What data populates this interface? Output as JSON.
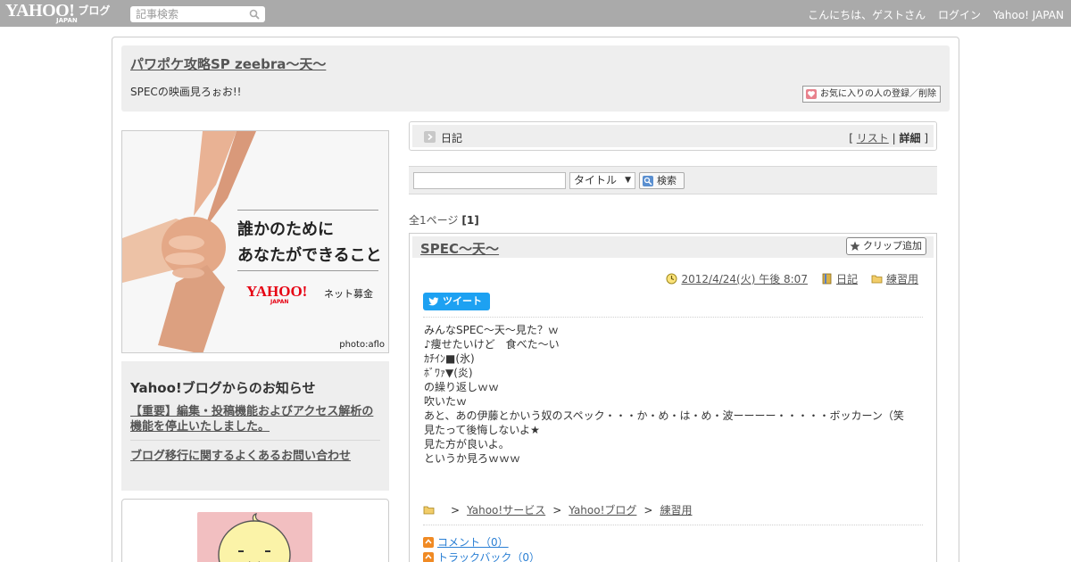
{
  "topbar": {
    "logo_text": "YAHOO!",
    "logo_sub": "JAPAN",
    "logo_blog": "ブログ",
    "search_placeholder": "記事検索",
    "greeting": "こんにちは、ゲストさん",
    "login": "ログイン",
    "yahoo_japan": "Yahoo! JAPAN"
  },
  "header": {
    "blog_title": "パワポケ攻略SP zeebra～天～",
    "description": "SPECの映画見ろぉお!!",
    "favorite_button": "お気に入りの人の登録／削除"
  },
  "banner": {
    "line1": "誰かのために",
    "line2": "あなたができること",
    "logo": "YAHOO!",
    "logo_sub": "JAPAN",
    "tagline": "ネット募金",
    "credit": "photo:aflo"
  },
  "notice": {
    "title": "Yahoo!ブログからのお知らせ",
    "link1": "【重要】編集・投稿機能およびアクセス解析の機能を停止いたしました。",
    "link2": "ブログ移行に関するよくあるお問い合わせ"
  },
  "category_bar": {
    "label": "日記",
    "view_open": "[",
    "view_list": "リスト",
    "view_sep": "|",
    "view_detail": "詳細",
    "view_close": "]"
  },
  "article_search": {
    "select_value": "タイトル",
    "button": "検索"
  },
  "page_info": {
    "text": "全1ページ",
    "current": "[1]"
  },
  "article": {
    "title": "SPEC～天～",
    "clip_button": "クリップ追加",
    "date": "2012/4/24(火) 午後 8:07",
    "category": "日記",
    "folder": "練習用",
    "tweet": "ツイート",
    "body_lines": [
      "みんなSPEC～天～見た？ｗ",
      "♪痩せたいけど　食べた～い",
      "ｶﾁｲﾝ■(氷)",
      "ﾎﾞﾜｧ▼(炎)",
      "の繰り返しｗｗ",
      "吹いたｗ",
      "あと、あの伊藤とかいう奴のスペック・・・か・め・は・め・波ーーーー・・・・・ボッカーン（笑",
      "見たって後悔しないよ★",
      "見た方が良いよ。",
      "というか見ろｗｗｗ"
    ],
    "breadcrumb": {
      "sep": ">",
      "items": [
        "Yahoo!サービス",
        "Yahoo!ブログ",
        "練習用"
      ]
    },
    "comments": "コメント（0）",
    "trackbacks": "トラックバック（0）"
  },
  "colors": {
    "topbar": "#aaaaaa",
    "panel": "#eeeeee",
    "tweet": "#1da1f2",
    "link_blue": "#2a7fd4"
  }
}
